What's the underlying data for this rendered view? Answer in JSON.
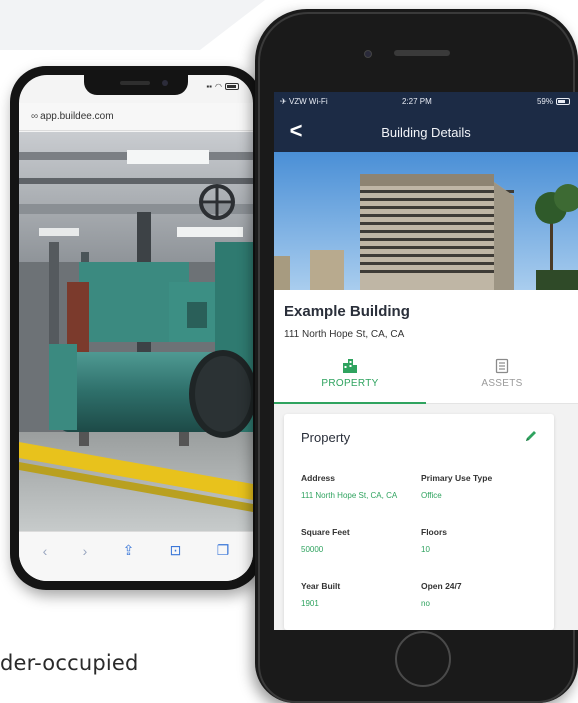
{
  "background_text": "der-occupied",
  "left_phone": {
    "url": "app.buildee.com"
  },
  "right_phone": {
    "status_bar": {
      "carrier": "VZW Wi-Fi",
      "time": "2:27 PM",
      "battery": "59%"
    },
    "nav": {
      "back_label": "<",
      "title": "Building Details"
    },
    "building": {
      "name": "Example Building",
      "address": "111 North Hope St, CA, CA"
    },
    "tabs": [
      {
        "label": "PROPERTY",
        "active": true
      },
      {
        "label": "ASSETS",
        "active": false
      }
    ],
    "card": {
      "title": "Property",
      "fields": [
        {
          "label": "Address",
          "value": "111 North Hope St, CA, CA"
        },
        {
          "label": "Primary Use Type",
          "value": "Office"
        },
        {
          "label": "Square Feet",
          "value": "50000"
        },
        {
          "label": "Floors",
          "value": "10"
        },
        {
          "label": "Year Built",
          "value": "1901"
        },
        {
          "label": "Open 24/7",
          "value": "no"
        }
      ]
    }
  },
  "colors": {
    "header_navy": "#1c2b45",
    "accent_green": "#2fa35f"
  }
}
